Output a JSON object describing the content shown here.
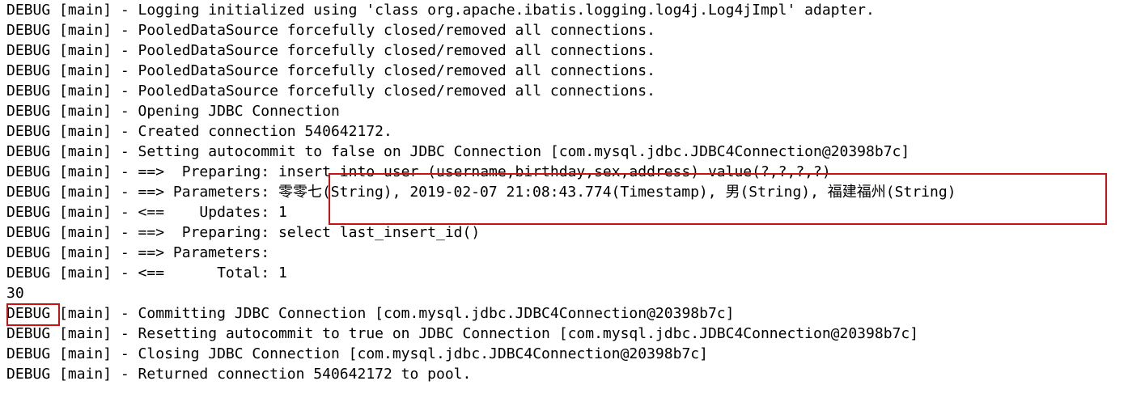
{
  "console": {
    "name": "java-console-output",
    "background_color": "#ffffff",
    "text_color": "#000000",
    "lines": [
      "DEBUG [main] - Logging initialized using 'class org.apache.ibatis.logging.log4j.Log4jImpl' adapter.",
      "DEBUG [main] - PooledDataSource forcefully closed/removed all connections.",
      "DEBUG [main] - PooledDataSource forcefully closed/removed all connections.",
      "DEBUG [main] - PooledDataSource forcefully closed/removed all connections.",
      "DEBUG [main] - PooledDataSource forcefully closed/removed all connections.",
      "DEBUG [main] - Opening JDBC Connection",
      "DEBUG [main] - Created connection 540642172.",
      "DEBUG [main] - Setting autocommit to false on JDBC Connection [com.mysql.jdbc.JDBC4Connection@20398b7c]",
      "DEBUG [main] - ==>  Preparing: insert into user (username,birthday,sex,address) value(?,?,?,?) ",
      "DEBUG [main] - ==> Parameters: 零零七(String), 2019-02-07 21:08:43.774(Timestamp), 男(String), 福建福州(String)",
      "DEBUG [main] - <==    Updates: 1",
      "DEBUG [main] - ==>  Preparing: select last_insert_id() ",
      "DEBUG [main] - ==> Parameters: ",
      "DEBUG [main] - <==      Total: 1",
      "30",
      "DEBUG [main] - Committing JDBC Connection [com.mysql.jdbc.JDBC4Connection@20398b7c]",
      "DEBUG [main] - Resetting autocommit to true on JDBC Connection [com.mysql.jdbc.JDBC4Connection@20398b7c]",
      "DEBUG [main] - Closing JDBC Connection [com.mysql.jdbc.JDBC4Connection@20398b7c]",
      "DEBUG [main] - Returned connection 540642172 to pool."
    ]
  },
  "annotations": {
    "highlight_color": "#cc1111",
    "boxes": [
      {
        "name": "sql-and-parameters-highlight",
        "label": "insert into user (username,birthday,sex,address) value(?,?,?,?) / 零零七(String), 2019-02-07 21:08:43.774(Timestamp), 男(String), 福建福州(String)"
      },
      {
        "name": "last-insert-id-result-highlight",
        "label": "30"
      }
    ]
  }
}
